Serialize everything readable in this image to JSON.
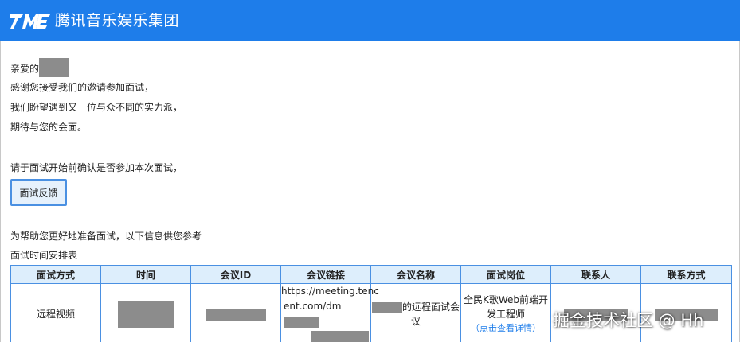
{
  "header": {
    "brand": "腾讯音乐娱乐集团",
    "logo_icon": "tme-logo-icon",
    "bg_color": "#1e7dea"
  },
  "greeting": {
    "prefix": "亲爱的",
    "line1": "感谢您接受我们的邀请参加面试，",
    "line2": "我们盼望遇到又一位与众不同的实力派，",
    "line3": "期待与您的会面。"
  },
  "confirm": {
    "text": "请于面试开始前确认是否参加本次面试，",
    "button_label": "面试反馈"
  },
  "info": {
    "intro": "为帮助您更好地准备面试，以下信息供您参考",
    "table_title": "面试时间安排表"
  },
  "table": {
    "headers": [
      "面试方式",
      "时间",
      "会议ID",
      "会议链接",
      "会议名称",
      "面试岗位",
      "联系人",
      "联系方式"
    ],
    "row": {
      "method": "远程视频",
      "link_part1": "https://meeting.tenc",
      "link_part2": "ent.com/dm",
      "meeting_name_suffix": "的远程面试会",
      "meeting_name_end": "议",
      "position_line1": "全民K歌Web前端开",
      "position_line2": "发工程师",
      "details_link": "（点击查看详情）"
    }
  },
  "watermark": "掘金技术社区 @ Hh"
}
